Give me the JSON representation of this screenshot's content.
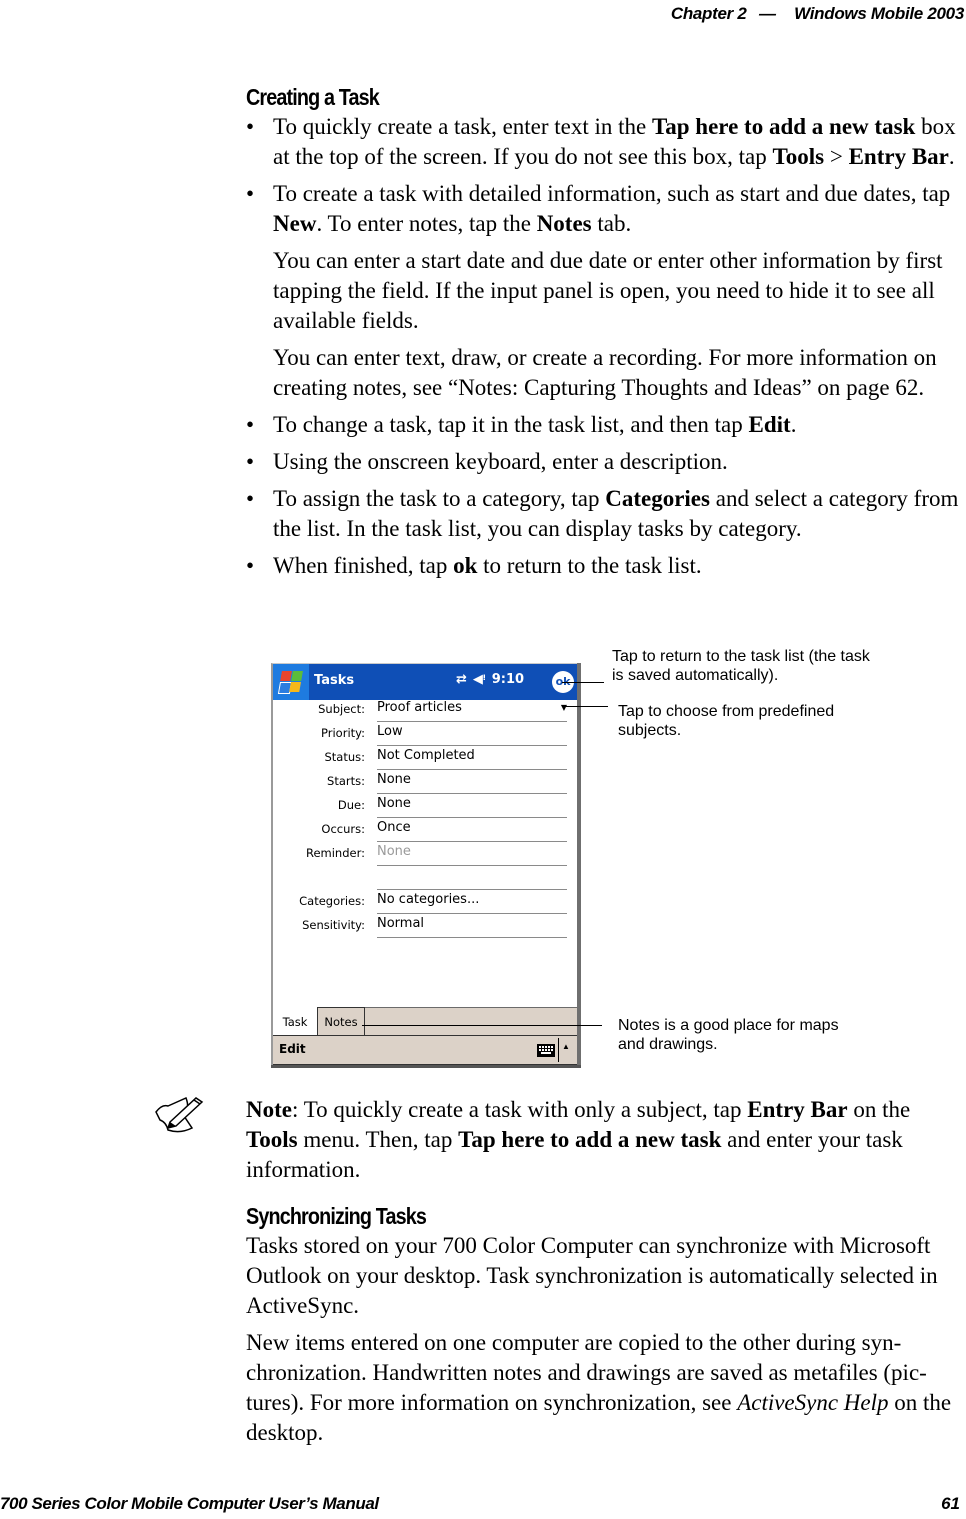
{
  "header": {
    "chapter": "Chapter  2",
    "separator": "—",
    "section": "Windows Mobile 2003"
  },
  "creating_task": {
    "heading": "Creating a Task",
    "bullet_char": "•",
    "b1": {
      "t1": "To quickly create a task, enter text in the ",
      "bold1": "Tap here to add a new task",
      "t2": " box at the top of the screen. If you do not see this box, tap ",
      "bold2": "Tools",
      "t3": " > ",
      "bold3": "Entry Bar",
      "t4": "."
    },
    "b2": {
      "t1": "To create a task with detailed information, such as start and due dates, tap ",
      "bold1": "New",
      "t2": ". To enter notes, tap the ",
      "bold2": "Notes",
      "t3": " tab."
    },
    "p1": "You can enter a start date and due date or enter other information by first tapping the field. If the input panel is open, you need to hide it to see all available fields.",
    "p2": "You can enter text, draw, or create a recording. For more information on creating notes, see “Notes: Capturing Thoughts and Ideas” on page 62.",
    "b3": {
      "t1": "To change a task, tap it in the task list, and then tap ",
      "bold1": "Edit",
      "t2": "."
    },
    "b4": {
      "t1": "Using the onscreen keyboard, enter a description."
    },
    "b5": {
      "t1": "To assign the task to a category, tap ",
      "bold1": "Categories",
      "t2": " and select a category from the list. In the task list, you can display tasks by category."
    },
    "b6": {
      "t1": "When finished, tap ",
      "bold1": "ok",
      "t2": " to return to the task list."
    }
  },
  "pda": {
    "app_title": "Tasks",
    "status": {
      "sync_icon": "⇄",
      "volume_icon": "◀ᵎ",
      "time": "9:10"
    },
    "ok_label": "ok",
    "fields": [
      {
        "label": "Subject:",
        "value": "Proof articles",
        "dropdown": true
      },
      {
        "label": "Priority:",
        "value": "Low"
      },
      {
        "label": "Status:",
        "value": "Not Completed"
      },
      {
        "label": "Starts:",
        "value": "None"
      },
      {
        "label": "Due:",
        "value": "None"
      },
      {
        "label": "Occurs:",
        "value": "Once"
      },
      {
        "label": "Reminder:",
        "value": "None",
        "dimmed": true
      },
      {
        "label": "",
        "value": ""
      },
      {
        "label": "Categories:",
        "value": "No categories..."
      },
      {
        "label": "Sensitivity:",
        "value": "Normal"
      }
    ],
    "tabs": [
      {
        "label": "Task",
        "active": true
      },
      {
        "label": "Notes",
        "active": false
      }
    ],
    "menu": {
      "edit": "Edit"
    },
    "colors": {
      "titlebar": "#0f4fb6",
      "start_button": "#1e7be0",
      "chrome": "#dcd2c8"
    }
  },
  "callouts": {
    "ok": "Tap to return to the task list (the task is saved automatically).",
    "subject": "Tap to choose from predefined subjects.",
    "notes": "Notes is a good place for maps and drawings."
  },
  "note": {
    "label": "Note",
    "t1": ": To quickly create a task with only a subject, tap ",
    "bold1": "Entry Bar",
    "t2": " on the ",
    "bold2": "Tools",
    "t3": " menu. Then, tap ",
    "bold3": "Tap here to add a new task",
    "t4": " and enter your task information."
  },
  "sync": {
    "heading": "Synchronizing Tasks",
    "p1": "Tasks stored on your 700 Color Computer can synchronize with Micro­soft Outlook on your desktop. Task synchronization is automatically se­lected in ActiveSync.",
    "p2_t1": "New items entered on one computer are copied to the other during syn­chronization. Handwritten notes and drawings are saved as metafiles (pic­tures). For more information on synchronization, see ",
    "p2_italic": "ActiveSync Help",
    "p2_t2": " on the desktop."
  },
  "footer": {
    "manual_title": "700 Series Color Mobile Computer User’s Manual",
    "page_number": "61"
  }
}
